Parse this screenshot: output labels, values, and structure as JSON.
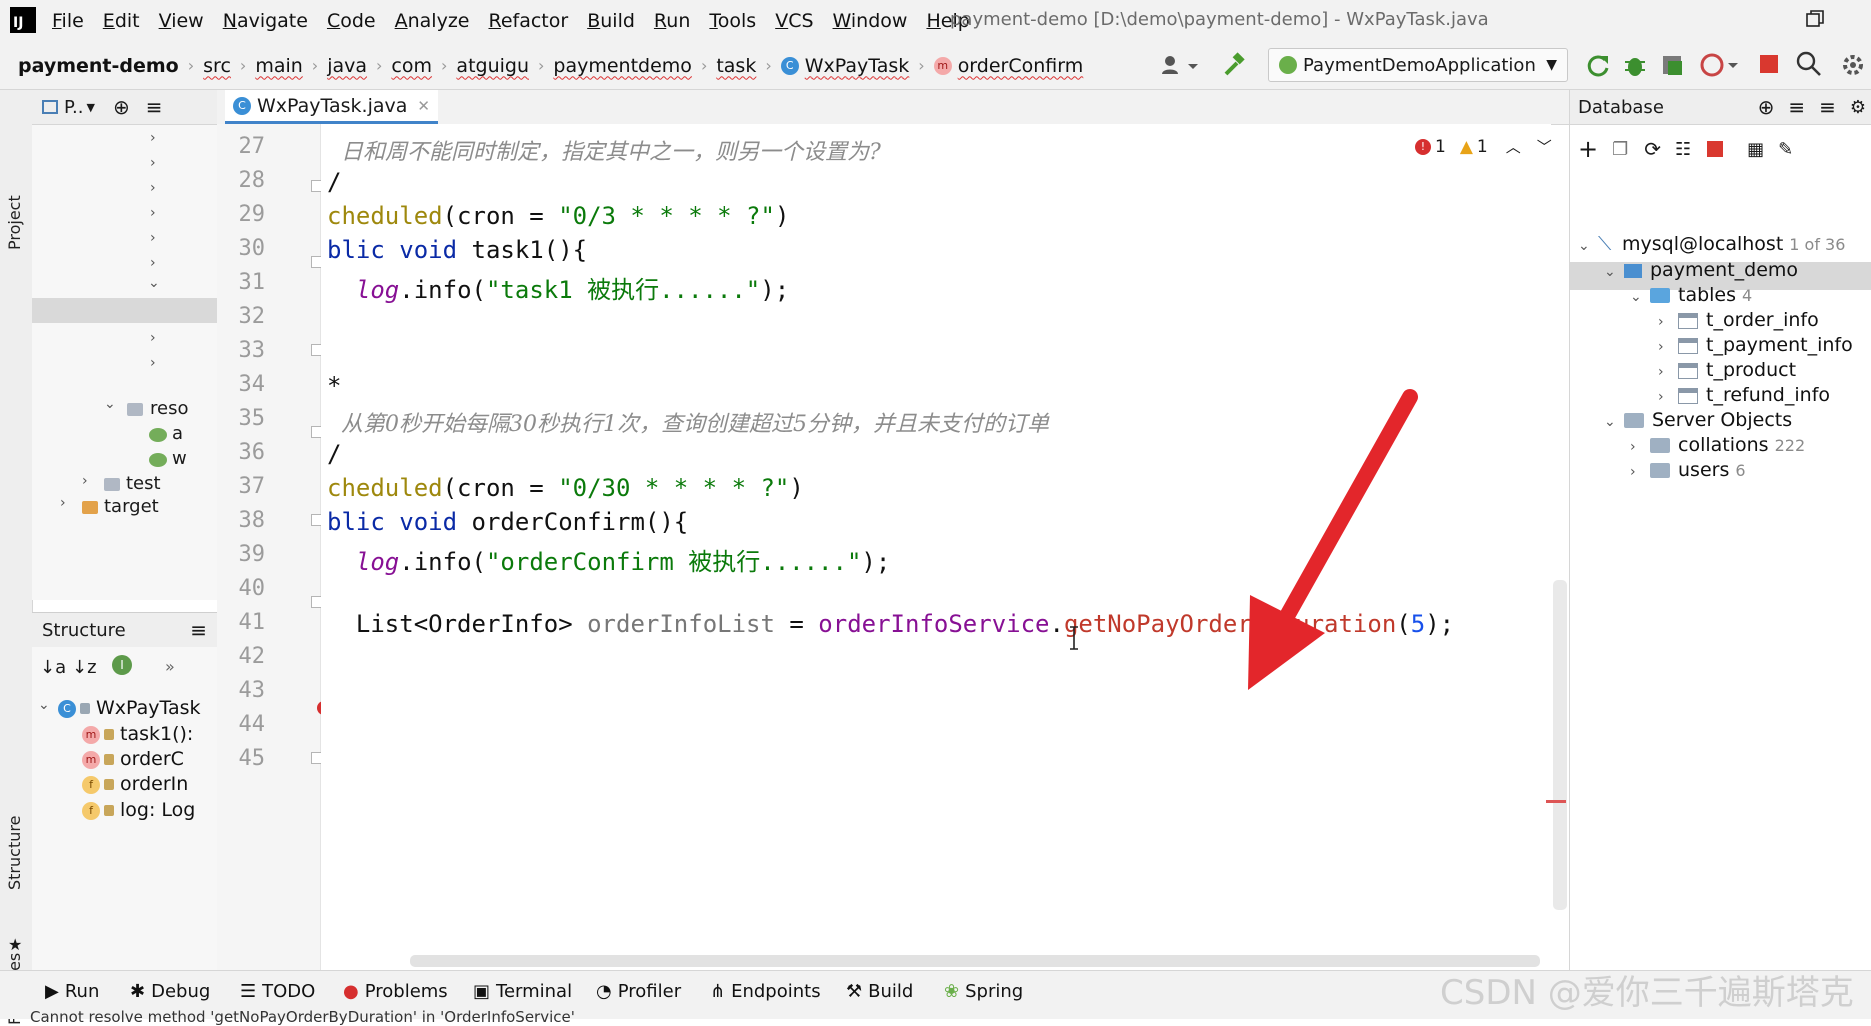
{
  "app": {
    "logo": "IJ",
    "window_title": "payment-demo [D:\\demo\\payment-demo] - WxPayTask.java",
    "menu": [
      "File",
      "Edit",
      "View",
      "Navigate",
      "Code",
      "Analyze",
      "Refactor",
      "Build",
      "Run",
      "Tools",
      "VCS",
      "Window",
      "Help"
    ]
  },
  "breadcrumb": [
    "payment-demo",
    "src",
    "main",
    "java",
    "com",
    "atguigu",
    "paymentdemo",
    "task",
    "WxPayTask",
    "orderConfirm"
  ],
  "run_config": "PaymentDemoApplication",
  "left_stripe": {
    "project": "Project",
    "structure": "Structure",
    "favorites": "Favorites"
  },
  "project_panel": {
    "title": "P..",
    "items": [
      "reso",
      "a",
      "w",
      "test",
      "target"
    ]
  },
  "structure_panel": {
    "title": "Structure",
    "class": "WxPayTask",
    "members": [
      {
        "kind": "m",
        "label": "task1():"
      },
      {
        "kind": "m",
        "label": "orderC"
      },
      {
        "kind": "f",
        "label": "orderIn"
      },
      {
        "kind": "f",
        "label": "log: Log"
      }
    ]
  },
  "editor": {
    "tab": "WxPayTask.java",
    "inspection": {
      "errors": "1",
      "warnings": "1"
    },
    "line_numbers": [
      "27",
      "28",
      "29",
      "30",
      "31",
      "32",
      "33",
      "34",
      "35",
      "36",
      "37",
      "38",
      "39",
      "40",
      "41",
      "42",
      "43",
      "44",
      "45"
    ],
    "lines": {
      "l27": "日和周不能同时制定，指定其中之一，则另一个设置为?",
      "l28": "/",
      "l29a": "cheduled",
      "l29b": "(cron = ",
      "l29c": "\"0/3 * * * * ?\"",
      "l29d": ")",
      "l30a": "blic ",
      "l30b": "void ",
      "l30c": "task1(){",
      "l31a": "  ",
      "l31b": "log",
      "l31c": ".info(",
      "l31d": "\"task1 被执行......\"",
      "l31e": ");",
      "l34": "*",
      "l35": "从第0秒开始每隔30秒执行1次，查询创建超过5分钟，并且未支付的订单",
      "l36": "/",
      "l37a": "cheduled",
      "l37b": "(cron = ",
      "l37c": "\"0/30 * * * * ?\"",
      "l37d": ")",
      "l38a": "blic ",
      "l38b": "void ",
      "l38c": "orderConfirm(){",
      "l39a": "  ",
      "l39b": "log",
      "l39c": ".info(",
      "l39d": "\"orderConfirm 被执行......\"",
      "l39e": ");",
      "l41a": "  List<OrderInfo> ",
      "l41b": "orderInfoList",
      "l41c": " = ",
      "l41d": "orderInfoService",
      "l41e": ".",
      "l41f": "getNoPayOrderByDuration",
      "l41g": "(",
      "l41h": "5",
      "l41i": ");"
    }
  },
  "database": {
    "title": "Database",
    "connection": "mysql@localhost",
    "connection_count": "1 of 36",
    "schema": "payment_demo",
    "tables_label": "tables",
    "tables_count": "4",
    "tables": [
      "t_order_info",
      "t_payment_info",
      "t_product",
      "t_refund_info"
    ],
    "server_objects": "Server Objects",
    "collations": "collations",
    "collations_count": "222",
    "users": "users",
    "users_count": "6"
  },
  "bottom_tools": [
    "Run",
    "Debug",
    "TODO",
    "Problems",
    "Terminal",
    "Profiler",
    "Endpoints",
    "Build",
    "Spring"
  ],
  "status": "Cannot resolve method 'getNoPayOrderByDuration' in 'OrderInfoService'",
  "watermark": "CSDN @爱你三千遍斯塔克",
  "colors": {
    "accent": "#4083c9",
    "arrow": "#e3262b",
    "error": "#d62f2f"
  }
}
